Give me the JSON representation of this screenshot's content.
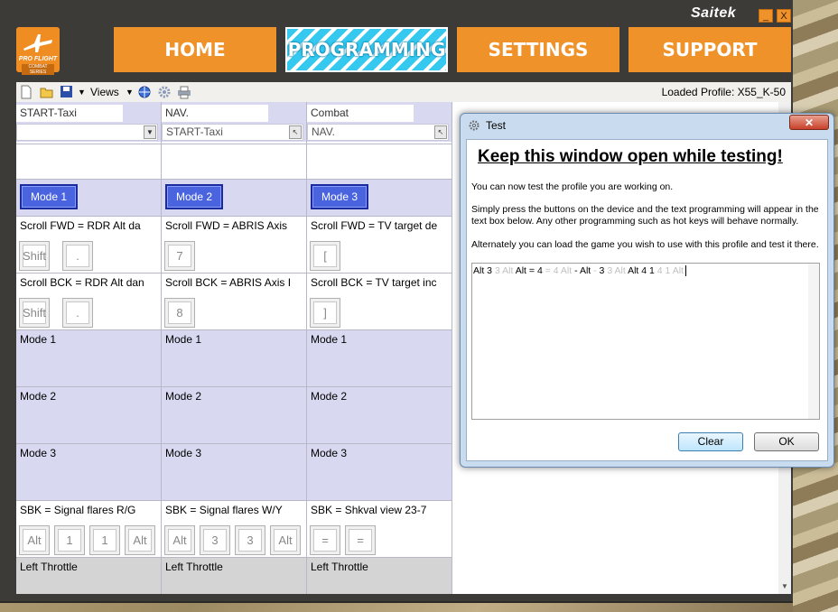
{
  "brand": "Saitek",
  "window_controls": {
    "minimize": "_",
    "close": "X"
  },
  "logo": {
    "line1": "PRO FLIGHT",
    "line2": "COMBAT SERIES"
  },
  "nav": [
    "HOME",
    "PROGRAMMING",
    "SETTINGS",
    "SUPPORT"
  ],
  "toolbar": {
    "views_label": "Views",
    "loaded_profile": "Loaded Profile: X55_K-50"
  },
  "columns": [
    {
      "header": "START-Taxi",
      "combo": "",
      "mode_button": "Mode 1",
      "fwd": "Scroll FWD = RDR Alt da",
      "fwd_keys": [
        "Shift",
        "."
      ],
      "bck": "Scroll BCK = RDR Alt dan",
      "bck_keys": [
        "Shift",
        "."
      ],
      "sbk": "SBK = Signal flares R/G",
      "sbk_keys": [
        "Alt",
        "1",
        "1",
        "Alt"
      ]
    },
    {
      "header": "NAV.",
      "combo": "START-Taxi",
      "mode_button": "Mode 2",
      "fwd": "Scroll FWD = ABRIS Axis",
      "fwd_keys": [
        "7"
      ],
      "bck": "Scroll BCK = ABRIS Axis I",
      "bck_keys": [
        "8"
      ],
      "sbk": "SBK = Signal flares W/Y",
      "sbk_keys": [
        "Alt",
        "3",
        "3",
        "Alt"
      ]
    },
    {
      "header": "Combat",
      "combo": "NAV.",
      "mode_button": "Mode 3",
      "fwd": "Scroll FWD = TV target de",
      "fwd_keys": [
        "["
      ],
      "bck": "Scroll BCK = TV target inc",
      "bck_keys": [
        "]"
      ],
      "sbk": "SBK = Shkval view 23-7",
      "sbk_keys": [
        "=",
        "="
      ]
    }
  ],
  "mode_rows": [
    "Mode 1",
    "Mode 2",
    "Mode 3"
  ],
  "footer_row": "Left Throttle",
  "dialog": {
    "title": "Test",
    "heading": "Keep this window open while testing!",
    "p1": "You can now test the profile you are working on.",
    "p2": "Simply press the buttons on the device and the text programming will appear in the text box below. Any other programming such as hot keys will behave normally.",
    "p3": "Alternately you can load the game you wish to use with this profile and test it there.",
    "test_output": [
      {
        "t": "Alt 3 ",
        "dim": false
      },
      {
        "t": "3 Alt ",
        "dim": true
      },
      {
        "t": "Alt = 4 ",
        "dim": false
      },
      {
        "t": "= 4 Alt ",
        "dim": true
      },
      {
        "t": "- Alt ",
        "dim": false
      },
      {
        "t": "- ",
        "dim": true
      },
      {
        "t": "3 ",
        "dim": false
      },
      {
        "t": "3 Alt ",
        "dim": true
      },
      {
        "t": "Alt 4 1 ",
        "dim": false
      },
      {
        "t": "4 1 Alt",
        "dim": true
      }
    ],
    "clear_label": "Clear",
    "ok_label": "OK"
  }
}
